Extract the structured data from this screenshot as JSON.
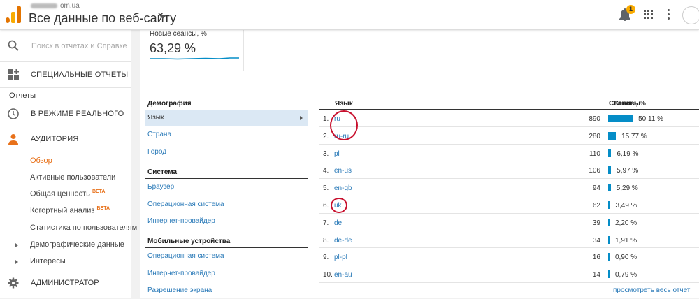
{
  "header": {
    "account_domain": "om.ua",
    "property_title": "Все данные по веб-сайту",
    "notification_count": "1"
  },
  "sidebar": {
    "search_placeholder": "Поиск в отчетах и Справке",
    "custom_reports": "СПЕЦИАЛЬНЫЕ ОТЧЕТЫ",
    "reports_section": "Отчеты",
    "realtime": "В РЕЖИМЕ РЕАЛЬНОГО",
    "audience": "АУДИТОРИЯ",
    "audience_items": [
      "Обзор",
      "Активные пользователи",
      "Общая ценность",
      "Когортный анализ",
      "Статистика по пользователям",
      "Демографические данные",
      "Интересы"
    ],
    "beta_label": "BETA",
    "admin": "АДМИНИСТРАТОР"
  },
  "metric": {
    "label": "Новые сеансы, %",
    "value": "63,29 %"
  },
  "dimensions": {
    "groups": [
      {
        "title": "Демография",
        "items": [
          "Язык",
          "Страна",
          "Город"
        ]
      },
      {
        "title": "Система",
        "items": [
          "Браузер",
          "Операционная система",
          "Интернет-провайдер"
        ]
      },
      {
        "title": "Мобильные устройства",
        "items": [
          "Операционная система",
          "Интернет-провайдер",
          "Разрешение экрана"
        ]
      }
    ],
    "selected": "Язык"
  },
  "table": {
    "col_language": "Язык",
    "col_sessions": "Сеансы",
    "col_sessions_pct": "Сеансы, %",
    "rows": [
      {
        "num": "1.",
        "lang": "ru",
        "sessions": "890",
        "pct": "50,11 %",
        "share": 50.11
      },
      {
        "num": "2.",
        "lang": "ru-ru",
        "sessions": "280",
        "pct": "15,77 %",
        "share": 15.77
      },
      {
        "num": "3.",
        "lang": "pl",
        "sessions": "110",
        "pct": "6,19 %",
        "share": 6.19
      },
      {
        "num": "4.",
        "lang": "en-us",
        "sessions": "106",
        "pct": "5,97 %",
        "share": 5.97
      },
      {
        "num": "5.",
        "lang": "en-gb",
        "sessions": "94",
        "pct": "5,29 %",
        "share": 5.29
      },
      {
        "num": "6.",
        "lang": "uk",
        "sessions": "62",
        "pct": "3,49 %",
        "share": 3.49
      },
      {
        "num": "7.",
        "lang": "de",
        "sessions": "39",
        "pct": "2,20 %",
        "share": 2.2
      },
      {
        "num": "8.",
        "lang": "de-de",
        "sessions": "34",
        "pct": "1,91 %",
        "share": 1.91
      },
      {
        "num": "9.",
        "lang": "pl-pl",
        "sessions": "16",
        "pct": "0,90 %",
        "share": 0.9
      },
      {
        "num": "10.",
        "lang": "en-au",
        "sessions": "14",
        "pct": "0,79 %",
        "share": 0.79
      }
    ],
    "view_all": "просмотреть весь отчет"
  },
  "colors": {
    "accent_orange": "#e8711a",
    "bar_blue": "#058dc7",
    "link_blue": "#2a7ab8",
    "annotation_red": "#c8102e"
  }
}
